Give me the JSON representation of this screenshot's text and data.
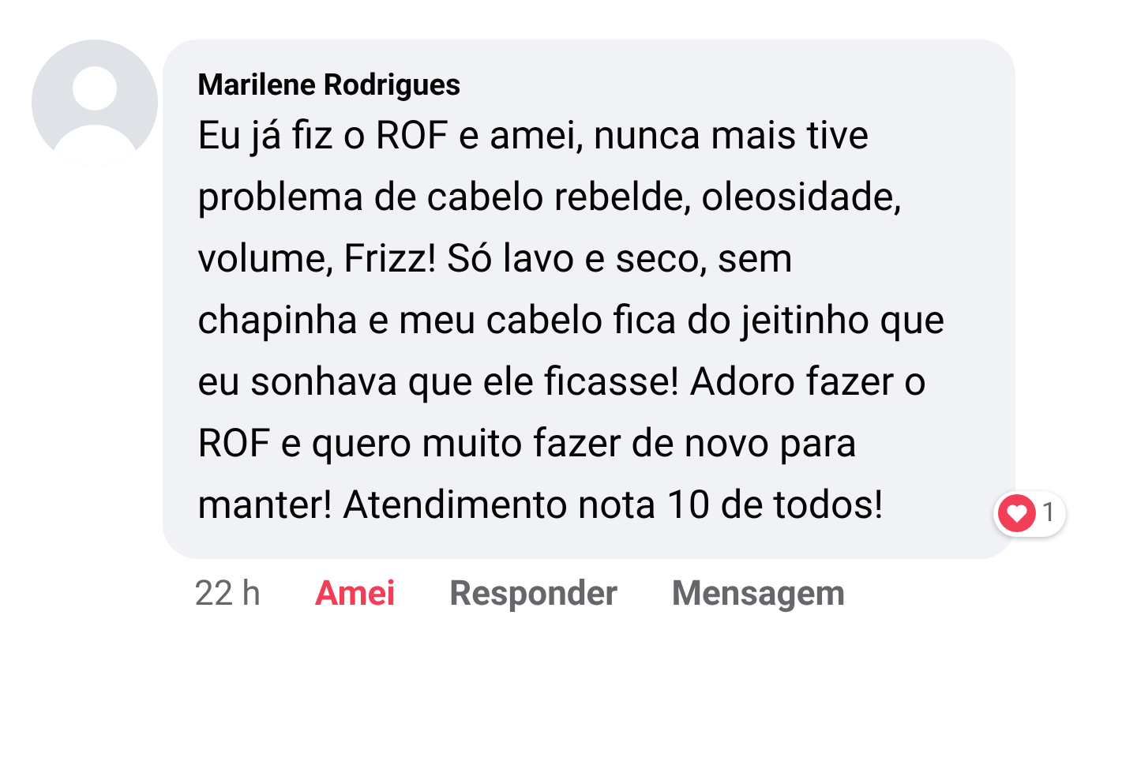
{
  "comment": {
    "author": "Marilene Rodrigues",
    "text": "Eu já fiz o ROF e amei, nunca mais tive problema de cabelo rebelde, oleosidade, volume, Frizz! Só lavo e seco, sem chapinha e meu cabelo fica do jeitinho que eu sonhava que ele ficasse! Adoro fazer o ROF e quero muito fazer de novo para manter! Atendimento nota 10 de todos!",
    "reaction_count": "1"
  },
  "actions": [
    {
      "kind": "time",
      "label": "22 h"
    },
    {
      "kind": "react",
      "label": "Amei",
      "selected": true
    },
    {
      "kind": "link",
      "label": "Responder"
    },
    {
      "kind": "link",
      "label": "Mensagem"
    }
  ]
}
